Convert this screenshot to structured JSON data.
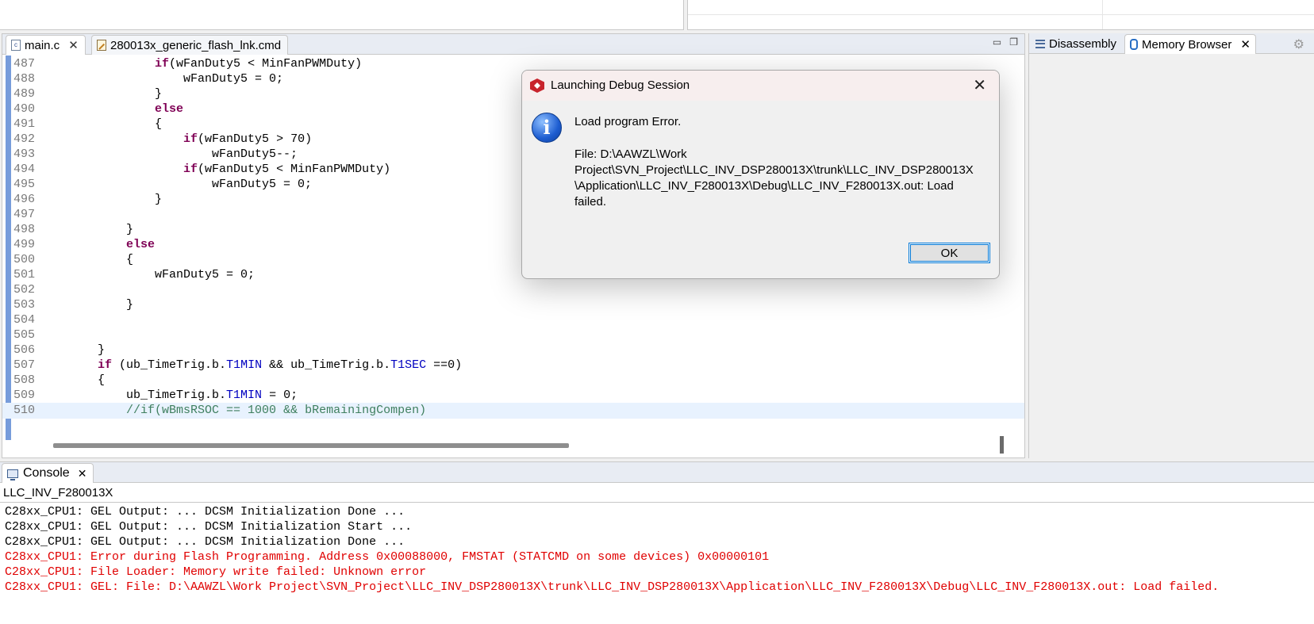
{
  "editor": {
    "tabs": [
      {
        "label": "main.c",
        "close": "✕"
      },
      {
        "label": "280013x_generic_flash_lnk.cmd"
      }
    ],
    "window_controls": {
      "minimize": "▭",
      "maximize": "❐"
    },
    "lines": [
      {
        "num": "487",
        "parts": [
          {
            "t": "                ",
            "c": ""
          },
          {
            "t": "if",
            "c": "kw"
          },
          {
            "t": "(wFanDuty5 < MinFanPWMDuty)",
            "c": ""
          }
        ]
      },
      {
        "num": "488",
        "parts": [
          {
            "t": "                    wFanDuty5 = 0;",
            "c": ""
          }
        ]
      },
      {
        "num": "489",
        "parts": [
          {
            "t": "                }",
            "c": ""
          }
        ]
      },
      {
        "num": "490",
        "parts": [
          {
            "t": "                ",
            "c": ""
          },
          {
            "t": "else",
            "c": "kw"
          }
        ]
      },
      {
        "num": "491",
        "parts": [
          {
            "t": "                {",
            "c": ""
          }
        ]
      },
      {
        "num": "492",
        "parts": [
          {
            "t": "                    ",
            "c": ""
          },
          {
            "t": "if",
            "c": "kw"
          },
          {
            "t": "(wFanDuty5 > 70)",
            "c": ""
          }
        ]
      },
      {
        "num": "493",
        "parts": [
          {
            "t": "                        wFanDuty5--;",
            "c": ""
          }
        ]
      },
      {
        "num": "494",
        "parts": [
          {
            "t": "                    ",
            "c": ""
          },
          {
            "t": "if",
            "c": "kw"
          },
          {
            "t": "(wFanDuty5 < MinFanPWMDuty)",
            "c": ""
          }
        ]
      },
      {
        "num": "495",
        "parts": [
          {
            "t": "                        wFanDuty5 = 0;",
            "c": ""
          }
        ]
      },
      {
        "num": "496",
        "parts": [
          {
            "t": "                }",
            "c": ""
          }
        ]
      },
      {
        "num": "497",
        "parts": [
          {
            "t": "",
            "c": ""
          }
        ]
      },
      {
        "num": "498",
        "parts": [
          {
            "t": "            }",
            "c": ""
          }
        ]
      },
      {
        "num": "499",
        "parts": [
          {
            "t": "            ",
            "c": ""
          },
          {
            "t": "else",
            "c": "kw"
          }
        ]
      },
      {
        "num": "500",
        "parts": [
          {
            "t": "            {",
            "c": ""
          }
        ]
      },
      {
        "num": "501",
        "parts": [
          {
            "t": "                wFanDuty5 = 0;",
            "c": ""
          }
        ]
      },
      {
        "num": "502",
        "parts": [
          {
            "t": "",
            "c": ""
          }
        ]
      },
      {
        "num": "503",
        "parts": [
          {
            "t": "            }",
            "c": ""
          }
        ]
      },
      {
        "num": "504",
        "parts": [
          {
            "t": "",
            "c": ""
          }
        ]
      },
      {
        "num": "505",
        "parts": [
          {
            "t": "",
            "c": ""
          }
        ]
      },
      {
        "num": "506",
        "parts": [
          {
            "t": "        }",
            "c": ""
          }
        ]
      },
      {
        "num": "507",
        "parts": [
          {
            "t": "        ",
            "c": ""
          },
          {
            "t": "if",
            "c": "kw"
          },
          {
            "t": " (ub_TimeTrig.b.",
            "c": ""
          },
          {
            "t": "T1MIN",
            "c": "fld"
          },
          {
            "t": " && ub_TimeTrig.b.",
            "c": ""
          },
          {
            "t": "T1SEC",
            "c": "fld"
          },
          {
            "t": " ==0)",
            "c": ""
          }
        ]
      },
      {
        "num": "508",
        "parts": [
          {
            "t": "        {",
            "c": ""
          }
        ]
      },
      {
        "num": "509",
        "parts": [
          {
            "t": "            ub_TimeTrig.b.",
            "c": ""
          },
          {
            "t": "T1MIN",
            "c": "fld"
          },
          {
            "t": " = 0;",
            "c": ""
          }
        ]
      },
      {
        "num": "510",
        "current": true,
        "parts": [
          {
            "t": "            ",
            "c": ""
          },
          {
            "t": "//if(wBmsRSOC == 1000 && bRemainingCompen)",
            "c": "cmt"
          }
        ]
      }
    ]
  },
  "right_panel": {
    "tabs": [
      {
        "label": "Disassembly"
      },
      {
        "label": "Memory Browser",
        "close": "✕"
      }
    ]
  },
  "console": {
    "tab_label": "Console",
    "tab_close": "✕",
    "name": "LLC_INV_F280013X",
    "lines": [
      {
        "text": "C28xx_CPU1: GEL Output: ... DCSM Initialization Done ...",
        "error": false
      },
      {
        "text": "C28xx_CPU1: GEL Output: ... DCSM Initialization Start ...",
        "error": false
      },
      {
        "text": "C28xx_CPU1: GEL Output: ... DCSM Initialization Done ...",
        "error": false
      },
      {
        "text": "C28xx_CPU1: Error during Flash Programming. Address 0x00088000, FMSTAT (STATCMD on some devices) 0x00000101",
        "error": true
      },
      {
        "text": "C28xx_CPU1: File Loader: Memory write failed: Unknown error",
        "error": true
      },
      {
        "text": "C28xx_CPU1: GEL: File: D:\\AAWZL\\Work Project\\SVN_Project\\LLC_INV_DSP280013X\\trunk\\LLC_INV_DSP280013X\\Application\\LLC_INV_F280013X\\Debug\\LLC_INV_F280013X.out: Load failed.",
        "error": true
      }
    ]
  },
  "dialog": {
    "title": "Launching Debug Session",
    "close": "✕",
    "icon": "i",
    "message": "Load program Error.",
    "path_lines": [
      "File: D:\\AAWZL\\Work",
      "Project\\SVN_Project\\LLC_INV_DSP280013X\\trunk\\LLC_INV_DSP280013X",
      "\\Application\\LLC_INV_F280013X\\Debug\\LLC_INV_F280013X.out: Load",
      "failed."
    ],
    "ok_label": "OK"
  },
  "colors": {
    "keyword": "#7f0055",
    "field": "#0000c0",
    "comment": "#3f7f5f",
    "error_text": "#e00000",
    "accent": "#0078d7"
  }
}
